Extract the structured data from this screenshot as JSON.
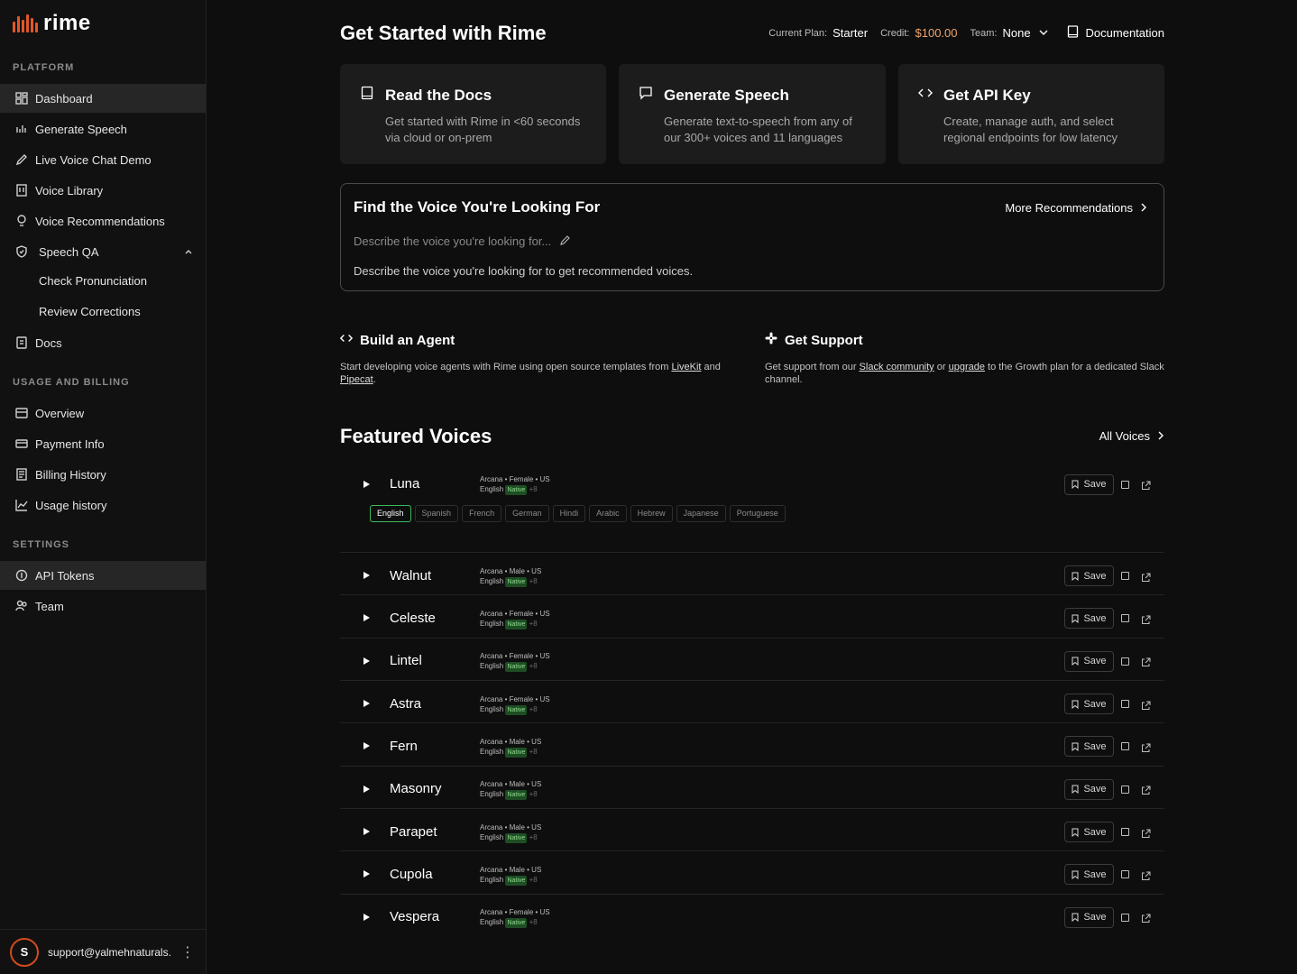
{
  "brand": {
    "name": "rime",
    "accent": "#e2572a"
  },
  "sidebar": {
    "platform_label": "PLATFORM",
    "platform_items": [
      {
        "label": "Dashboard",
        "icon": "grid-icon"
      },
      {
        "label": "Generate Speech",
        "icon": "bars-icon"
      },
      {
        "label": "Live Voice Chat Demo",
        "icon": "pen-icon"
      },
      {
        "label": "Voice Library",
        "icon": "library-icon"
      },
      {
        "label": "Voice Recommendations",
        "icon": "bulb-icon"
      },
      {
        "label": "Speech QA",
        "icon": "shield-icon"
      }
    ],
    "qa_sub": [
      "Check Pronunciation",
      "Review Corrections"
    ],
    "docs_label": "Docs",
    "billing_label": "USAGE AND BILLING",
    "billing_items": [
      "Overview",
      "Payment Info",
      "Billing History",
      "Usage history"
    ],
    "settings_label": "SETTINGS",
    "settings_items": [
      "API Tokens",
      "Team"
    ],
    "user": {
      "initial": "S",
      "email": "support@yalmehnaturals..."
    }
  },
  "header": {
    "title": "Get Started with Rime",
    "plan_label": "Current Plan:",
    "plan_value": "Starter",
    "credit_label": "Credit:",
    "credit_value": "$100.00",
    "team_label": "Team:",
    "team_value": "None",
    "docs_link": "Documentation"
  },
  "cards": [
    {
      "title": "Read the Docs",
      "desc": "Get started with Rime in <60 seconds via cloud or on-prem",
      "icon": "book-icon"
    },
    {
      "title": "Generate Speech",
      "desc": "Generate text-to-speech from any of our 300+ voices and 11 languages",
      "icon": "chat-icon"
    },
    {
      "title": "Get API Key",
      "desc": "Create, manage auth, and select regional endpoints for low latency",
      "icon": "code-icon"
    }
  ],
  "finder": {
    "title": "Find the Voice You're Looking For",
    "more": "More Recommendations",
    "placeholder": "Describe the voice you're looking for...",
    "hint": "Describe the voice you're looking for to get recommended voices."
  },
  "agent": {
    "title": "Build an Agent",
    "desc_pre": "Start developing voice agents with Rime using open source templates from ",
    "link1": "LiveKit",
    "desc_mid": " and ",
    "link2": "Pipecat",
    "desc_post": "."
  },
  "support": {
    "title": "Get Support",
    "desc_pre": "Get support from our ",
    "link1": "Slack community",
    "desc_mid": " or ",
    "link2": "upgrade",
    "desc_post": " to the Growth plan for a dedicated Slack channel."
  },
  "featured": {
    "title": "Featured Voices",
    "all_link": "All Voices",
    "save_label": "Save",
    "native_label": "Native",
    "plus_label": "+8",
    "languages": [
      "English",
      "Spanish",
      "French",
      "German",
      "Hindi",
      "Arabic",
      "Hebrew",
      "Japanese",
      "Portuguese"
    ],
    "voices": [
      {
        "name": "Luna",
        "meta": "Arcana • Female • US",
        "lang": "English"
      },
      {
        "name": "Walnut",
        "meta": "Arcana • Male • US",
        "lang": "English"
      },
      {
        "name": "Celeste",
        "meta": "Arcana • Female • US",
        "lang": "English"
      },
      {
        "name": "Lintel",
        "meta": "Arcana • Female • US",
        "lang": "English"
      },
      {
        "name": "Astra",
        "meta": "Arcana • Female • US",
        "lang": "English"
      },
      {
        "name": "Fern",
        "meta": "Arcana • Male • US",
        "lang": "English"
      },
      {
        "name": "Masonry",
        "meta": "Arcana • Male • US",
        "lang": "English"
      },
      {
        "name": "Parapet",
        "meta": "Arcana • Male • US",
        "lang": "English"
      },
      {
        "name": "Cupola",
        "meta": "Arcana • Male • US",
        "lang": "English"
      },
      {
        "name": "Vespera",
        "meta": "Arcana • Female • US",
        "lang": "English"
      }
    ]
  }
}
